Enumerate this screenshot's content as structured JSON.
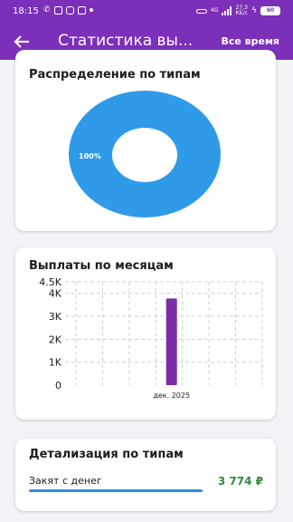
{
  "status_bar": {
    "time": "18:15",
    "network_label": "4G",
    "speed_value": "27,3",
    "speed_unit": "КБ/с",
    "battery": "60"
  },
  "app_bar": {
    "title": "Статистика вы...",
    "period": "Все время",
    "color": "#7c2fb8"
  },
  "distribution": {
    "title": "Распределение по типам",
    "chart_data": {
      "type": "pie",
      "slices": [
        {
          "label": "100%",
          "value": 100,
          "color": "#2f9ae8"
        }
      ]
    }
  },
  "monthly": {
    "title": "Выплаты по месяцам",
    "chart_data": {
      "type": "bar",
      "categories": [
        "дек. 2025"
      ],
      "values": [
        3774
      ],
      "ylim": [
        0,
        4500
      ],
      "yticks": [
        "0",
        "1K",
        "2K",
        "3K",
        "4K",
        "4.5K"
      ],
      "ytick_values": [
        0,
        1000,
        2000,
        3000,
        4000,
        4500
      ],
      "bar_color": "#7b2ca8",
      "grid": true
    }
  },
  "details": {
    "title": "Детализация по типам",
    "items": [
      {
        "label": "Закят с денег",
        "value": "3 774 ₽",
        "bar_color": "#2f8ddf"
      }
    ]
  }
}
